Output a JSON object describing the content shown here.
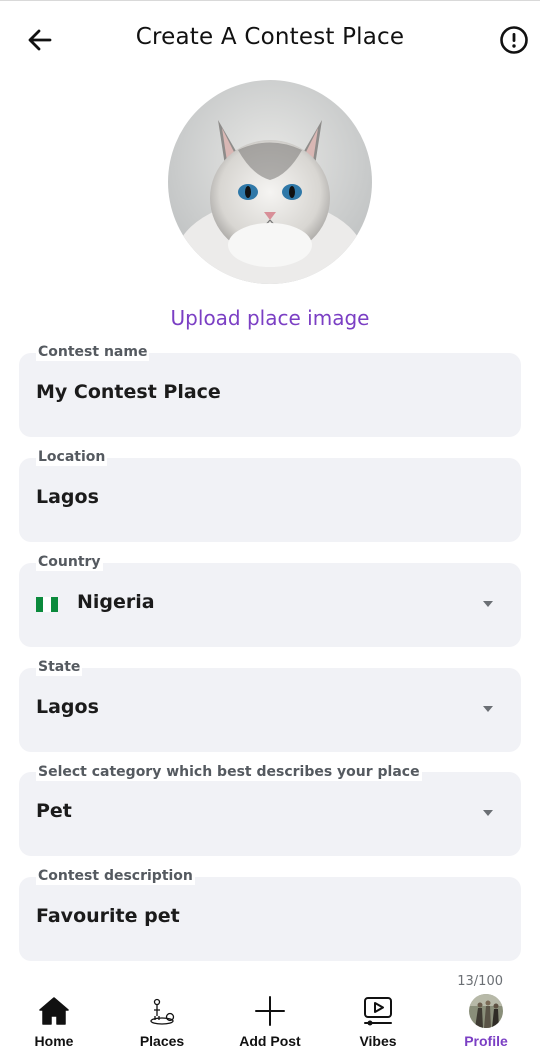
{
  "header": {
    "title": "Create A Contest Place",
    "back_icon": "arrow-left-icon",
    "info_icon": "info-circle-icon"
  },
  "image_upload": {
    "link_text": "Upload place image",
    "image_desc": "cat-photo"
  },
  "fields": {
    "contest_name": {
      "label": "Contest name",
      "value": "My Contest Place"
    },
    "location": {
      "label": "Location",
      "value": "Lagos"
    },
    "country": {
      "label": "Country",
      "value": "Nigeria",
      "flag": "nigeria-flag"
    },
    "state": {
      "label": "State",
      "value": "Lagos"
    },
    "category": {
      "label": "Select category which best describes your place",
      "value": "Pet"
    },
    "description": {
      "label": "Contest description",
      "value": "Favourite pet",
      "counter": "13/100"
    }
  },
  "bottom_nav": {
    "items": [
      {
        "label": "Home",
        "icon": "home-icon"
      },
      {
        "label": "Places",
        "icon": "places-icon"
      },
      {
        "label": "Add Post",
        "icon": "plus-icon"
      },
      {
        "label": "Vibes",
        "icon": "video-play-icon"
      },
      {
        "label": "Profile",
        "icon": "profile-avatar"
      }
    ],
    "active_color": "#7b3fc4"
  },
  "colors": {
    "accent": "#7b3fc4",
    "field_bg": "#f1f2f6",
    "nigeria_green": "#0b8a3c"
  }
}
